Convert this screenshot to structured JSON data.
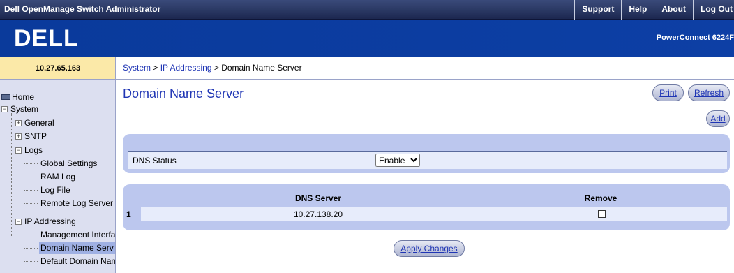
{
  "app_title": "Dell OpenManage Switch Administrator",
  "topnav": [
    "Support",
    "Help",
    "About",
    "Log Out"
  ],
  "brand": {
    "logo_text": "DELL",
    "model": "PowerConnect 6224F"
  },
  "ip_address": "10.27.65.163",
  "breadcrumb": {
    "part1": "System",
    "sep1": " > ",
    "part2": "IP Addressing",
    "sep2": " > ",
    "current": "Domain Name Server"
  },
  "tree": {
    "home": "Home",
    "system": "System",
    "general": "General",
    "sntp": "SNTP",
    "logs": "Logs",
    "global_settings": "Global Settings",
    "ram_log": "RAM Log",
    "log_file": "Log File",
    "remote_log_server": "Remote Log Server",
    "ip_addressing": "IP Addressing",
    "management_interface": "Management Interfa",
    "domain_name_server": "Domain Name Serv",
    "default_domain_name": "Default Domain Nan"
  },
  "page": {
    "title": "Domain Name Server",
    "print_label": "Print",
    "refresh_label": "Refresh",
    "add_label": "Add",
    "dns_status_label": "DNS Status",
    "dns_status_value": "Enable",
    "dns_status_options": [
      "Enable"
    ],
    "table_headers": {
      "server": "DNS Server",
      "remove": "Remove"
    },
    "rows": [
      {
        "index": "1",
        "server": "10.27.138.20",
        "remove": false
      }
    ],
    "apply_label": "Apply Changes"
  }
}
